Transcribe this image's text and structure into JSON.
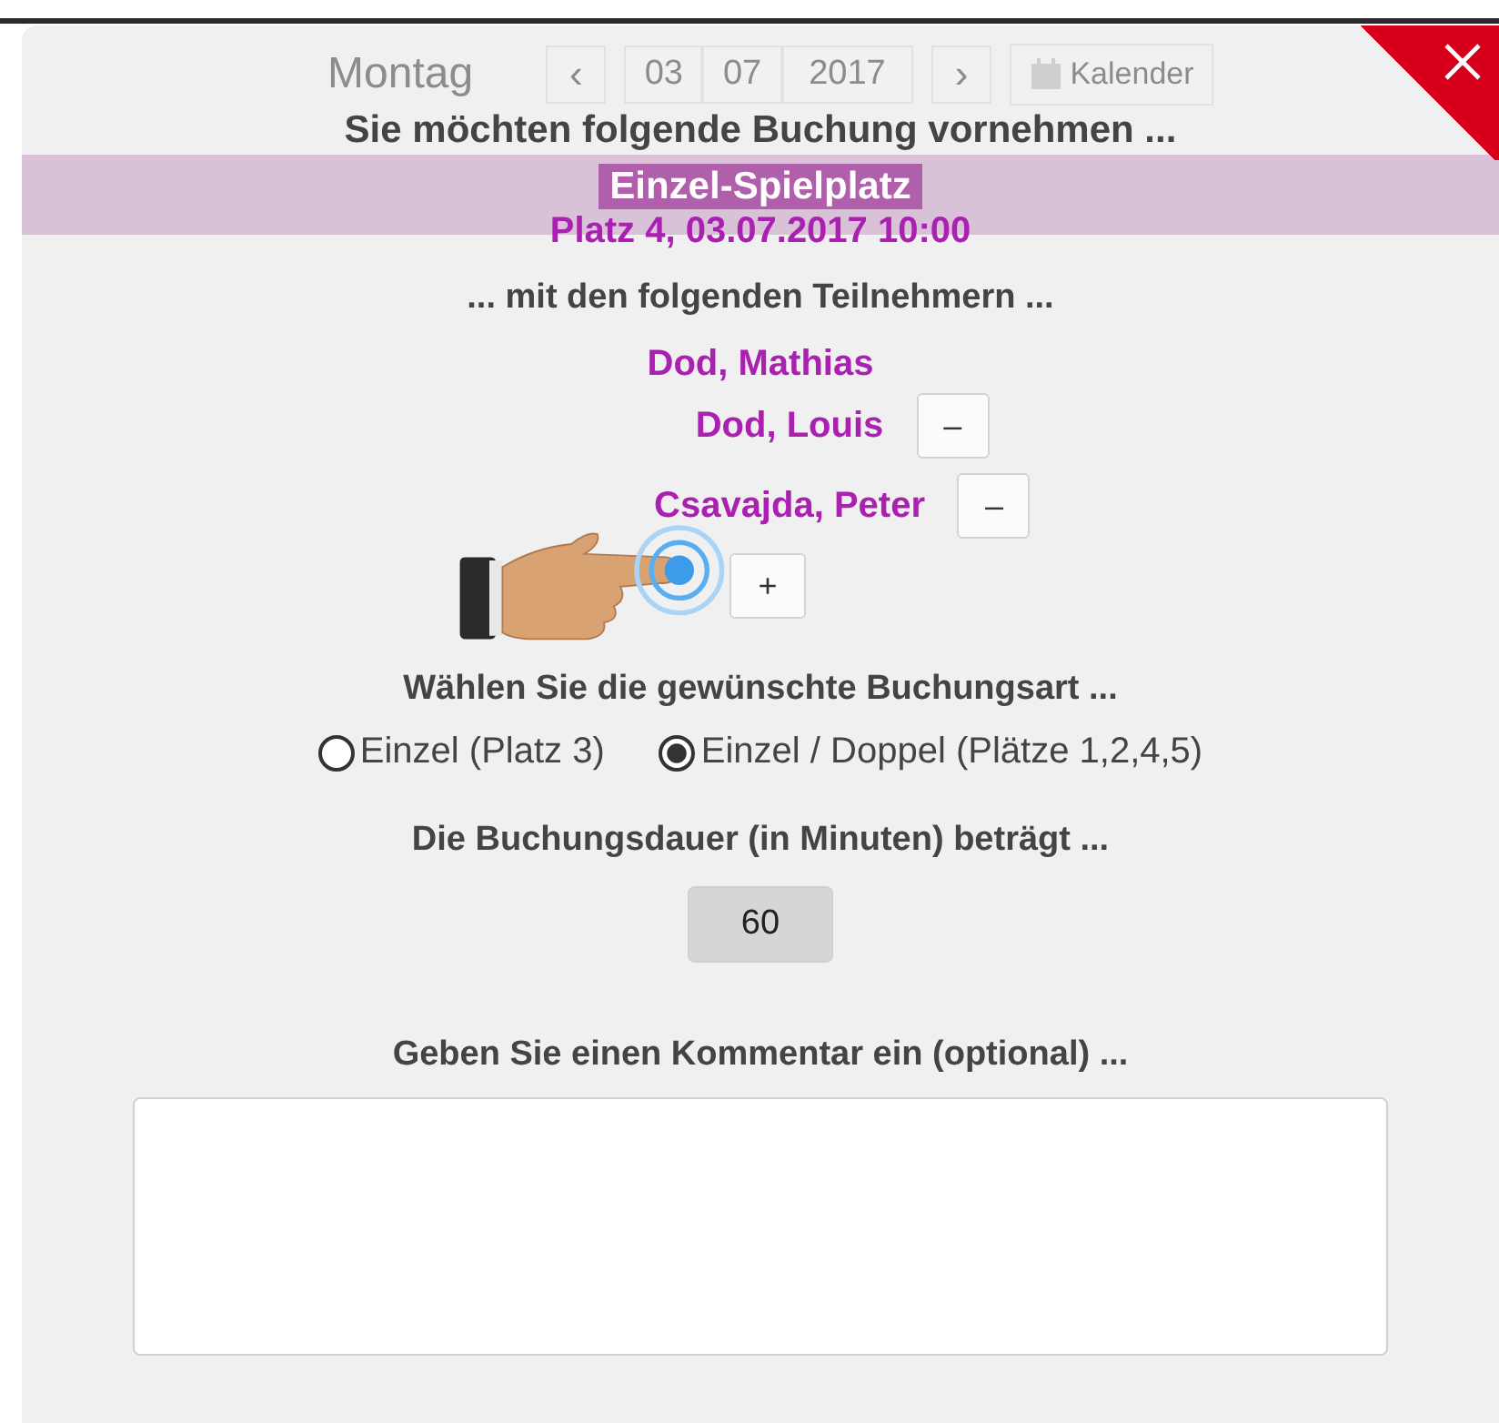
{
  "background": {
    "day": "Montag",
    "prev": "‹",
    "date": [
      "03",
      "07",
      "2017"
    ],
    "next": "›",
    "calendar_button": "Kalender",
    "court_title": "Einzel-Spielplatz"
  },
  "dialog": {
    "title": "Sie möchten folgende Buchung vornehmen ...",
    "booking": "Platz 4, 03.07.2017 10:00",
    "participants_heading": "... mit den folgenden Teilnehmern ...",
    "participants": [
      {
        "name": "Dod, Mathias",
        "removable": false
      },
      {
        "name": "Dod, Louis",
        "removable": true
      },
      {
        "name": "Csavajda, Peter",
        "removable": true
      }
    ],
    "remove_label": "–",
    "add_label": "+",
    "type_heading": "Wählen Sie die gewünschte Buchungsart ...",
    "types": [
      {
        "label": "Einzel (Platz 3)",
        "selected": false
      },
      {
        "label": "Einzel / Doppel (Plätze 1,2,4,5)",
        "selected": true
      }
    ],
    "duration_heading": "Die Buchungsdauer (in Minuten) beträgt ...",
    "duration": "60",
    "comment_heading": "Geben Sie einen Kommentar ein (optional) ..."
  }
}
